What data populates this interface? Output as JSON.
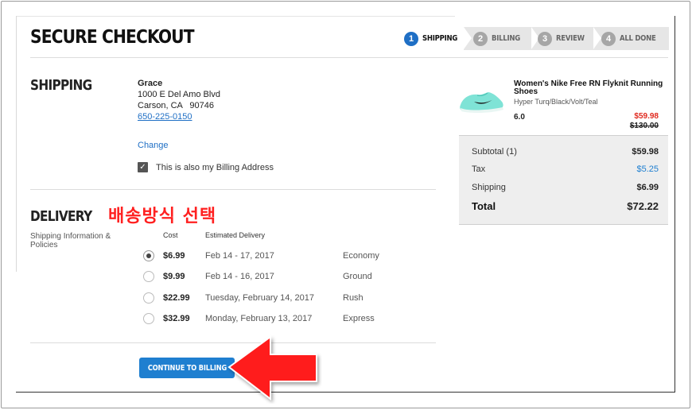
{
  "page_title": "SECURE CHECKOUT",
  "steps": [
    {
      "num": "1",
      "label": "SHIPPING",
      "active": true
    },
    {
      "num": "2",
      "label": "BILLING",
      "active": false
    },
    {
      "num": "3",
      "label": "REVIEW",
      "active": false
    },
    {
      "num": "4",
      "label": "ALL DONE",
      "active": false
    }
  ],
  "shipping": {
    "heading": "SHIPPING",
    "name": "Grace",
    "address_line1": "1000 E Del Amo Blvd",
    "address_line2": "Carson, CA   90746",
    "phone": "650-225-0150",
    "change_label": "Change",
    "billing_same_label": "This is also my Billing Address",
    "billing_same_checked": true
  },
  "delivery": {
    "heading": "DELIVERY",
    "annotation": "배송방식 선택",
    "info_label": "Shipping Information & Policies",
    "col_cost": "Cost",
    "col_estimated": "Estimated Delivery",
    "options": [
      {
        "cost": "$6.99",
        "date": "Feb 14 - 17, 2017",
        "method": "Economy",
        "selected": true
      },
      {
        "cost": "$9.99",
        "date": "Feb 14 - 16, 2017",
        "method": "Ground",
        "selected": false
      },
      {
        "cost": "$22.99",
        "date": "Tuesday, February 14, 2017",
        "method": "Rush",
        "selected": false
      },
      {
        "cost": "$32.99",
        "date": "Monday, February 13, 2017",
        "method": "Express",
        "selected": false
      }
    ],
    "continue_label": "CONTINUE TO BILLING"
  },
  "product": {
    "name": "Women's Nike Free RN Flyknit Running Shoes",
    "color": "Hyper Turq/Black/Volt/Teal",
    "size": "6.0",
    "price": "$59.98",
    "original_price": "$130.00"
  },
  "summary": {
    "subtotal_label": "Subtotal (1)",
    "subtotal_value": "$59.98",
    "tax_label": "Tax",
    "tax_value": "$5.25",
    "shipping_label": "Shipping",
    "shipping_value": "$6.99",
    "total_label": "Total",
    "total_value": "$72.22"
  },
  "colors": {
    "accent_blue": "#1f7fd0",
    "annotation_red": "#ff2020",
    "sale_red": "#e0281d"
  }
}
